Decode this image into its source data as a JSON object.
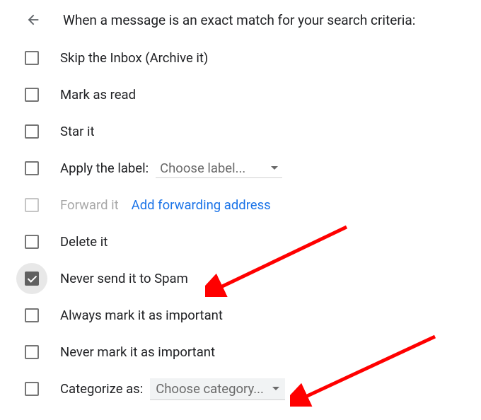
{
  "header": {
    "title": "When a message is an exact match for your search criteria:"
  },
  "options": {
    "skip_inbox": "Skip the Inbox (Archive it)",
    "mark_read": "Mark as read",
    "star_it": "Star it",
    "apply_label": "Apply the label:",
    "apply_label_dropdown": "Choose label...",
    "forward_it": "Forward it",
    "forward_link": "Add forwarding address",
    "delete_it": "Delete it",
    "never_spam": "Never send it to Spam",
    "always_important": "Always mark it as important",
    "never_important": "Never mark it as important",
    "categorize_as": "Categorize as:",
    "categorize_dropdown": "Choose category..."
  },
  "annotations": {
    "arrow_color": "#ff0000"
  }
}
